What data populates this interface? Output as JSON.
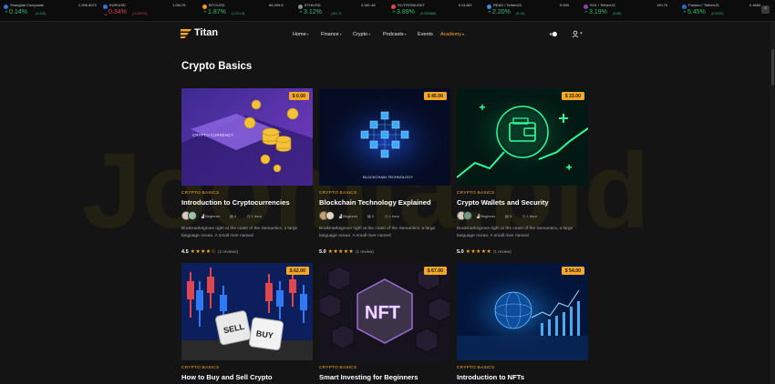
{
  "ticker": {
    "items": [
      {
        "symbol": "Shanghai Composite",
        "price": "2,996.8972",
        "change": "0.14%",
        "sub": "(4.310)",
        "direction": "up",
        "icon_color": "#3b6fd9"
      },
      {
        "symbol": "EUR/USD",
        "price": "1.08178",
        "change": "0.34%",
        "sub": "(-0.00373)",
        "direction": "down",
        "icon_color": "#2e74d6"
      },
      {
        "symbol": "BTC/USD",
        "price": "66,499.8",
        "change": "1.87%",
        "sub": "(1,221.9)",
        "direction": "up",
        "icon_color": "#f39c12"
      },
      {
        "symbol": "ETH/USD",
        "price": "3,361.48",
        "change": "3.12%",
        "sub": "(101.7)",
        "direction": "up",
        "icon_color": "#8c8c8c"
      },
      {
        "symbol": "SC/TRON/USDT",
        "price": "0.01483",
        "change": "3.89%",
        "sub": "(0.000566)",
        "direction": "up",
        "icon_color": "#e0464e"
      },
      {
        "symbol": "READ / TetherUS",
        "price": "5.555",
        "change": "2.20%",
        "sub": "(0.12)",
        "direction": "up",
        "icon_color": "#3a8bd8"
      },
      {
        "symbol": "SOL / TetherUS",
        "price": "190.75",
        "change": "3.19%",
        "sub": "(5.88)",
        "direction": "up",
        "icon_color": "#8e44ad"
      },
      {
        "symbol": "Fantom / TetherUS",
        "price": "0.4684",
        "change": "5.45%",
        "sub": "(0.0242)",
        "direction": "up",
        "icon_color": "#1f6fd1"
      }
    ],
    "close_label": "×"
  },
  "header": {
    "brand": "Titan",
    "nav": [
      {
        "label": "Home",
        "caret": true
      },
      {
        "label": "Finance",
        "caret": true
      },
      {
        "label": "Crypto",
        "caret": true
      },
      {
        "label": "Podcasts",
        "caret": true
      },
      {
        "label": "Events",
        "caret": false
      },
      {
        "label": "Academy",
        "caret": true,
        "active": true
      }
    ],
    "caret_glyph": "▾"
  },
  "page": {
    "title": "Crypto Basics",
    "watermark": "Joomla.bid"
  },
  "cards": [
    {
      "price": "$ 0.00",
      "category": "CRYPTO BASICS",
      "title": "Introduction to Cryptocurrencies",
      "level": "Beginner",
      "lessons": "4",
      "duration": "1 hour",
      "desc": "Bookmarksgrove right at the coast of the Semantics, a large language ocean. A small river named",
      "score": "4.5",
      "stars": "★★★★☆",
      "reviews": "(2 reviews)",
      "thumb_text": "CRYPTO CURRENCY"
    },
    {
      "price": "$ 45.00",
      "category": "CRYPTO BASICS",
      "title": "Blockchain Technology Explained",
      "level": "Beginner",
      "lessons": "2",
      "duration": "1 hour",
      "desc": "Bookmarksgrove right at the coast of the Semantics, a large language ocean. A small river named",
      "score": "5.0",
      "stars": "★★★★★",
      "reviews": "(1 review)",
      "thumb_text": "BLOCKCHAIN TECHNOLOGY"
    },
    {
      "price": "$ 33.00",
      "category": "CRYPTO BASICS",
      "title": "Crypto Wallets and Security",
      "level": "Beginner",
      "lessons": "3",
      "duration": "1 hour",
      "desc": "Bookmarksgrove right at the coast of the Semantics, a large language ocean. A small river named",
      "score": "5.0",
      "stars": "★★★★★",
      "reviews": "(1 review)",
      "thumb_text": ""
    },
    {
      "price": "$ 62.00",
      "category": "CRYPTO BASICS",
      "title": "How to Buy and Sell Crypto",
      "thumb_text": "SELL BUY"
    },
    {
      "price": "$ 67.00",
      "category": "CRYPTO BASICS",
      "title": "Smart Investing for Beginners",
      "thumb_text": "NFT"
    },
    {
      "price": "$ 54.00",
      "category": "CRYPTO BASICS",
      "title": "Introduction to NFTs",
      "thumb_text": ""
    }
  ]
}
